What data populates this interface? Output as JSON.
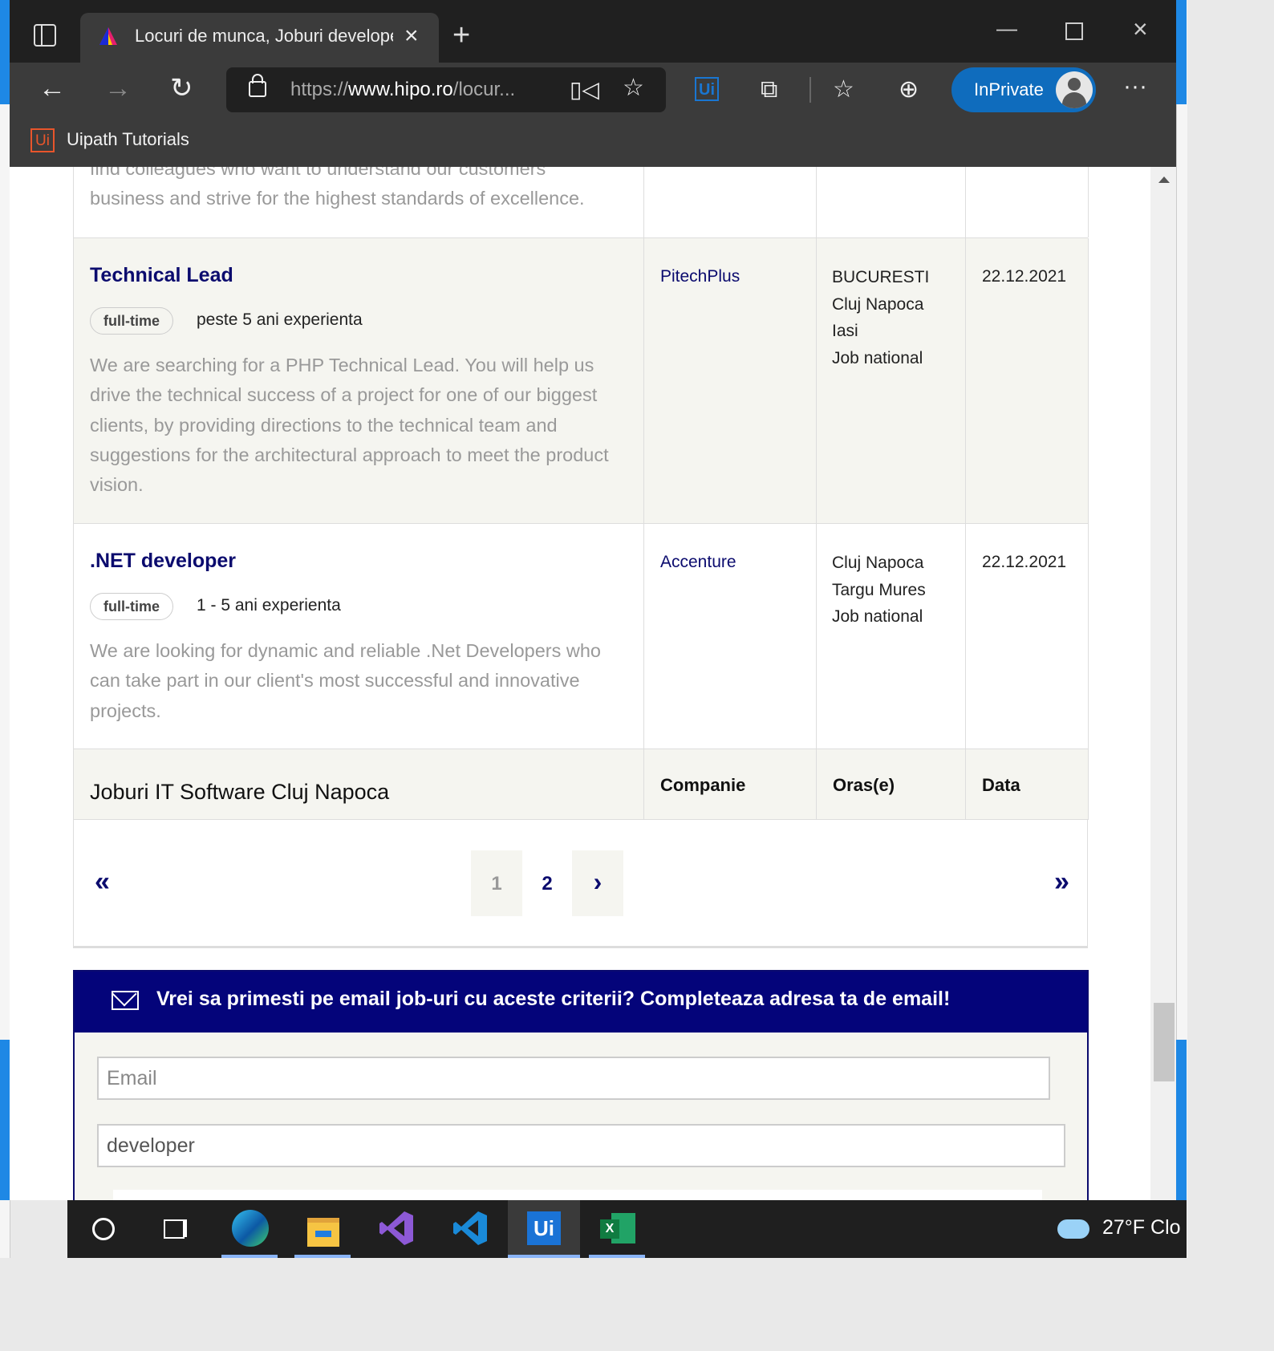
{
  "browser": {
    "tab_title": "Locuri de munca, Joburi developer",
    "url_prefix": "https://",
    "url_domain": "www.hipo.ro",
    "url_path": "/locur...",
    "inprivate_label": "InPrivate",
    "favorites_bar": {
      "item_label": "Uipath Tutorials",
      "item_icon": "Ui"
    },
    "ui_extension_icon": "Ui"
  },
  "page": {
    "partial_description_line1": "find colleagues who want to understand our customers",
    "partial_description_line2": "business and strive for the highest standards of excellence.",
    "jobs": [
      {
        "title": "Technical Lead",
        "type": "full-time",
        "experience": "peste 5 ani experienta",
        "description": "We are searching for a PHP Technical Lead. You will help us drive the technical success of a project for one of our biggest clients, by providing directions to the technical team and suggestions for the architectural approach to meet the product vision.",
        "company": "PitechPlus",
        "cities": [
          "BUCURESTI",
          "Cluj Napoca",
          "Iasi",
          "Job national"
        ],
        "date": "22.12.2021"
      },
      {
        "title": ".NET developer",
        "type": "full-time",
        "experience": "1 - 5 ani experienta",
        "description": "We are looking for dynamic and reliable .Net Developers who can take part in our client's most successful and innovative projects.",
        "company": "Accenture",
        "cities": [
          "Cluj Napoca",
          "Targu Mures",
          "Job national"
        ],
        "date": "22.12.2021"
      }
    ],
    "footer_header": {
      "title": "Joburi IT Software Cluj Napoca",
      "company": "Companie",
      "cities": "Oras(e)",
      "date": "Data"
    },
    "pagination": {
      "first": "«",
      "pages": [
        "1",
        "2"
      ],
      "next": "›",
      "last": "»"
    },
    "email_alert": {
      "heading": "Vrei sa primesti pe email job-uri cu aceste criterii? Completeaza adresa ta de email!",
      "email_placeholder": "Email",
      "keyword_value": "developer"
    }
  },
  "taskbar": {
    "weather": "27°F  Clo",
    "ui_app_label": "Ui",
    "excel_label": "X"
  },
  "colors": {
    "accent": "#04047a",
    "link": "#0b0b6e",
    "desc": "#999999",
    "row_alt": "#f5f5f0"
  }
}
